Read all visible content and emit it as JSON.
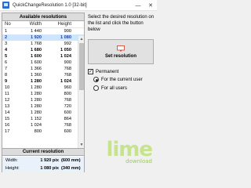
{
  "window": {
    "title": "QuickChangeResolution 1.0  [32-bit]"
  },
  "available": {
    "header": "Available resolutions",
    "columns": {
      "no": "No",
      "width": "Width",
      "height": "Height"
    },
    "rows": [
      {
        "no": "1",
        "width": "1 440",
        "height": "900",
        "bold": false,
        "selected": false
      },
      {
        "no": "2",
        "width": "1 920",
        "height": "1 080",
        "bold": true,
        "selected": true
      },
      {
        "no": "3",
        "width": "1 768",
        "height": "992",
        "bold": false,
        "selected": false
      },
      {
        "no": "4",
        "width": "1 680",
        "height": "1 050",
        "bold": true,
        "selected": false
      },
      {
        "no": "5",
        "width": "1 600",
        "height": "1 024",
        "bold": true,
        "selected": false
      },
      {
        "no": "6",
        "width": "1 600",
        "height": "900",
        "bold": false,
        "selected": false
      },
      {
        "no": "7",
        "width": "1 366",
        "height": "768",
        "bold": false,
        "selected": false
      },
      {
        "no": "8",
        "width": "1 360",
        "height": "768",
        "bold": false,
        "selected": false
      },
      {
        "no": "9",
        "width": "1 280",
        "height": "1 024",
        "bold": true,
        "selected": false
      },
      {
        "no": "10",
        "width": "1 280",
        "height": "960",
        "bold": false,
        "selected": false
      },
      {
        "no": "11",
        "width": "1 280",
        "height": "800",
        "bold": false,
        "selected": false
      },
      {
        "no": "12",
        "width": "1 280",
        "height": "768",
        "bold": false,
        "selected": false
      },
      {
        "no": "13",
        "width": "1 280",
        "height": "720",
        "bold": false,
        "selected": false
      },
      {
        "no": "14",
        "width": "1 280",
        "height": "600",
        "bold": false,
        "selected": false
      },
      {
        "no": "15",
        "width": "1 152",
        "height": "864",
        "bold": false,
        "selected": false
      },
      {
        "no": "16",
        "width": "1 024",
        "height": "768",
        "bold": false,
        "selected": false
      },
      {
        "no": "17",
        "width": "800",
        "height": "600",
        "bold": false,
        "selected": false
      }
    ]
  },
  "current": {
    "header": "Current resolution",
    "width_label": "Width:",
    "width_value": "1 920 pix",
    "width_mm": "(600 mm)",
    "height_label": "Height:",
    "height_value": "1 080 pix",
    "height_mm": "(340 mm)"
  },
  "right": {
    "instruction": "Select the desired resolution on the list and click the button below",
    "set_button": "Set resolution",
    "permanent_label": "Permanent",
    "permanent_checked": true,
    "current_user_label": "For the current user",
    "all_users_label": "For all users"
  },
  "watermark": {
    "brand": "lime",
    "sub": "download"
  }
}
